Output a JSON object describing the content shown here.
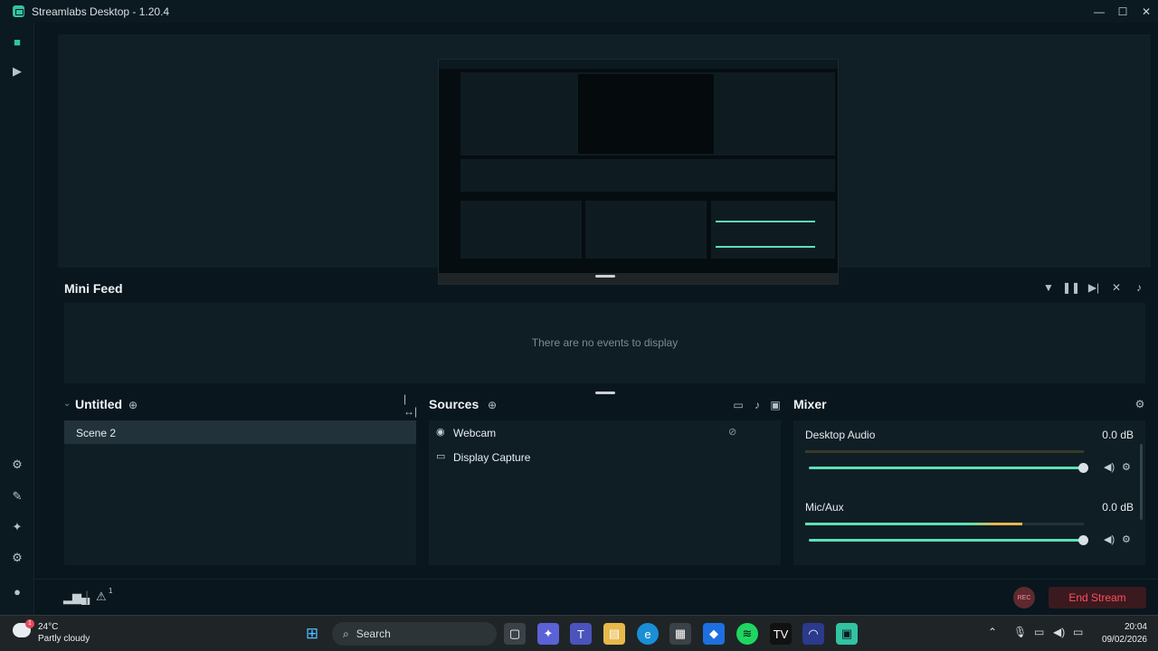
{
  "window": {
    "title": "Streamlabs Desktop - 1.20.4"
  },
  "mini_feed": {
    "title": "Mini Feed",
    "empty_text": "There are no events to display"
  },
  "scenes": {
    "collection": "Untitled",
    "items": [
      "Scene 2"
    ]
  },
  "sources": {
    "title": "Sources",
    "items": [
      "Webcam",
      "Display Capture"
    ]
  },
  "mixer": {
    "title": "Mixer",
    "channels": [
      {
        "name": "Desktop Audio",
        "db": "0.0 dB",
        "level": 0.0,
        "fader": 1.0
      },
      {
        "name": "Mic/Aux",
        "db": "0.0 dB",
        "level": 0.78,
        "fader": 1.0
      }
    ]
  },
  "bottom": {
    "end_stream": "End Stream",
    "rec": "REC",
    "alert_count": "1"
  },
  "taskbar": {
    "weather_temp": "24°C",
    "weather_desc": "Partly cloudy",
    "weather_badge": "1",
    "search": "Search",
    "time": "20:04",
    "date": "09/02/2026"
  },
  "colors": {
    "accent": "#5ee0b6",
    "end_stream": "#ff4d5e",
    "background": "#09161d"
  }
}
